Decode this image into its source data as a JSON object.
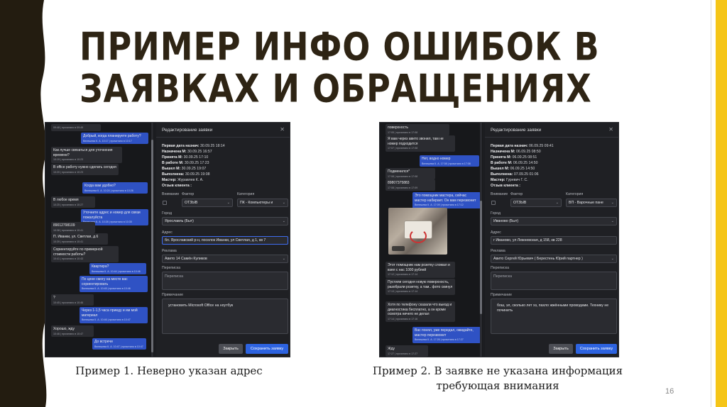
{
  "slide": {
    "title": "ПРИМЕР ИНФО ОШИБОК В ЗАЯВКАХ И ОБРАЩЕНИЯХ",
    "page_number": "16",
    "accent_color": "#f5c518",
    "edge_color": "#231c10"
  },
  "example1": {
    "caption": "Пример 1. Неверно указан адрес",
    "chat": [
      {
        "side": "in",
        "text": "",
        "meta": "09:48 | прочитано в 09:49"
      },
      {
        "side": "out",
        "text": "Добрый, когда планируете работу?",
        "meta": "Велешева К. А. 10:17 | прочитано в 10:17"
      },
      {
        "side": "in",
        "text": "Как лучше связаться для уточнения времени?",
        "meta": "10:19 | прочитано в 10:23"
      },
      {
        "side": "in",
        "text": "В office работу нужно сделать сегодня",
        "meta": "10:20 | прочитано в 10:23"
      },
      {
        "side": "out",
        "text": "Когда вам удобно?",
        "meta": "Велешева К. А. 10:24 | прочитано в 10:26"
      },
      {
        "side": "in",
        "text": "В любое время",
        "meta": "10:25 | прочитано в 10:27"
      },
      {
        "side": "out",
        "text": "Уточните адрес и номер для связи пожалуйста",
        "meta": "Велешева К. А. 10:28 | прочитано в 10:35"
      },
      {
        "side": "in",
        "text": "89012798109",
        "meta": "10:38 | прочитано в 10:41"
      },
      {
        "side": "in",
        "text": "П. Иванки, ул. Светлая, д.6",
        "meta": "10:39 | прочитано в 10:41"
      },
      {
        "side": "in",
        "text": "Сориентируйте по примерной стоимости работы?",
        "meta": "10:41 | прочитано в 10:43"
      },
      {
        "side": "out",
        "text": "Квартира?",
        "meta": "Велешева К. А. 10:44 | прочитано в 10:46"
      },
      {
        "side": "out",
        "text": "По цене смогу на месте вас сориентировать",
        "meta": "Велешева К. А. 10:45 | прочитано в 10:46"
      },
      {
        "side": "in",
        "text": "?",
        "meta": "10:45 | прочитано в 10:46"
      },
      {
        "side": "out",
        "text": "Через 1-1,5 часа приеду и им мой материал",
        "meta": "Велешева К. А. 10:46 | прочитано в 10:47"
      },
      {
        "side": "in",
        "text": "Хорошо, жду",
        "meta": "10:46 | прочитано в 10:47"
      },
      {
        "side": "out",
        "text": "До встречи",
        "meta": "Велешева К. А. 10:47 | прочитано в 10:47"
      }
    ],
    "panel": {
      "title": "Редактирование заявки",
      "lines": [
        {
          "label": "Первая дата назнач:",
          "value": "30.09.25 18:14"
        },
        {
          "label": "Назначена М:",
          "value": "30.09.25 16:57"
        },
        {
          "label": "Принята М:",
          "value": "30.09.25 17:10"
        },
        {
          "label": "В работе М:",
          "value": "30.09.25 17:23"
        },
        {
          "label": "Вышел М:",
          "value": "30.09.25 19:07"
        },
        {
          "label": "Выполнена:",
          "value": "30.09.25 19:08"
        },
        {
          "label": "Мастер:",
          "value": "Журавлев К. А."
        },
        {
          "label": "Отзыв клиента :",
          "value": ""
        }
      ],
      "attention_label": "Внимание",
      "factor_label": "Фактор",
      "factor_value": "ОТЗЫВ",
      "category_label": "Категория",
      "category_value": "ПК - Компьютеры и",
      "city_label": "Город",
      "city_value": "Ярославль (Быт)",
      "address_label": "Адрес",
      "address_value": "бл. Ярославский р-н, поселок Иванки, ул Светлая, д 1, кв 7",
      "ad_label": "Реклама",
      "ad_value": "Авито 14 Самён Куликов",
      "correspondence_label": "Переписка",
      "correspondence_value": "Переписка",
      "note_label": "Примечание",
      "note_value": "установить Microsoft Office на ноутбук",
      "close_button": "Закрыть",
      "save_button": "Сохранить заявку"
    }
  },
  "example2": {
    "caption": "Пример 2. В заявке не указана информация требующая внимания",
    "chat": [
      {
        "side": "in",
        "text": "поверхность",
        "meta": "17:05 | прочитано в 17:08"
      },
      {
        "side": "in",
        "text": "Я вам через авито звонил, там не номер подходится",
        "meta": "17:07 | прочитано в 17:08"
      },
      {
        "side": "out",
        "text": "Нет, водно номер",
        "meta": "Велешева К. А. 17:08 | прочитано в 17:08"
      },
      {
        "side": "in",
        "text": "Подменился*",
        "meta": "17:08 | прочитано в 17:08"
      },
      {
        "side": "in",
        "text": "89807375883",
        "meta": "17:08 | прочитано в 17:09"
      },
      {
        "side": "out",
        "text": "Это помощник мастера, сейчас мастер набирает. Он вам перезвонит",
        "meta": "Велешева К. А. 17:09 | прочитано в 17:12"
      },
      {
        "side": "in",
        "text": "Этот помощник нам розетку сломал и взял с нас 1000 рублей",
        "meta": "17:12 | прочитано в 17:14"
      },
      {
        "side": "in",
        "text": "Пустили сегодня новую поверхность, разобрали розетку, а там.. фото скинул",
        "meta": "17:13 | прочитано в 17:14"
      },
      {
        "side": "in",
        "text": "Хотя по телефону сказали что выезд и диагностика бесплатно, а он кроме осмотра ничего не делал",
        "meta": "17:14 | прочитано в 17:16"
      },
      {
        "side": "out",
        "text": "Вас понял, уже передал, ожидайте, мастер перезвонит",
        "meta": "Велешева К. А. 17:26 | прочитано в 17:27"
      },
      {
        "side": "in",
        "text": "Жду",
        "meta": "17:27 | прочитано в 17:27"
      }
    ],
    "panel": {
      "title": "Редактирование заявки",
      "lines": [
        {
          "label": "Первая дата назнач:",
          "value": "06.09.25 09:41"
        },
        {
          "label": "Назначена М:",
          "value": "06.09.25 08:50"
        },
        {
          "label": "Принята М:",
          "value": "06.09.25 08:51"
        },
        {
          "label": "В работе М:",
          "value": "06.09.25 14:50"
        },
        {
          "label": "Вышел М:",
          "value": "06.09.25 14:50"
        },
        {
          "label": "Выполнена:",
          "value": "07.09.25 01:06"
        },
        {
          "label": "Мастер:",
          "value": "Гуревич Г. С."
        },
        {
          "label": "Отзыв клиента :",
          "value": ""
        }
      ],
      "attention_label": "Внимание",
      "factor_label": "Фактор",
      "factor_value": "ОТЗЫВ",
      "category_label": "Категория",
      "category_value": "ВП - Варочные пане",
      "city_label": "Город",
      "city_value": "Иваново (Быт)",
      "address_label": "Адрес",
      "address_value": "г Иваново, ул Лежневская, д 158, кв 228",
      "ad_label": "Реклама",
      "ad_value": "Авито Сергей Юрьевич ( Берестень Юрий партнер )",
      "correspondence_label": "Переписка",
      "correspondence_value": "Переписка",
      "note_label": "Примечание",
      "note_value": "бош, эл, сколько лет хз, пахло жжёнными проводами. Технику не починить",
      "close_button": "Закрыть",
      "save_button": "Сохранить заявку"
    }
  }
}
